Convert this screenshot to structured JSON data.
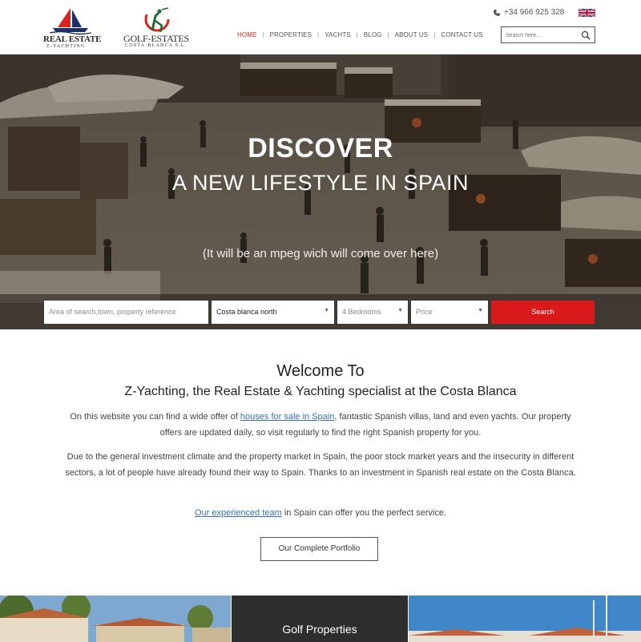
{
  "brand": {
    "logo1_title": "REAL ESTATE",
    "logo1_sub": "Z-YACHTING",
    "logo2_title": "GOLF-ESTATES",
    "logo2_sub": "COSTA·BLANCA S.L."
  },
  "header": {
    "phone": "+34 966 925 328",
    "language_icon": "uk-flag-icon",
    "nav": [
      {
        "label": "HOME",
        "active": true
      },
      {
        "label": "PROPERTIES"
      },
      {
        "label": "YACHTS"
      },
      {
        "label": "BLOG"
      },
      {
        "label": "ABOUT US"
      },
      {
        "label": "CONTACT US"
      }
    ],
    "search_placeholder": "Search here...",
    "accent_color": "#d9231c"
  },
  "hero": {
    "title": "DISCOVER",
    "subtitle": "A NEW LIFESTYLE IN  SPAIN",
    "note": "(It will be an mpeg wich will come over here)",
    "search": {
      "area_placeholder": "Area of search,town, property reference",
      "region": "Costa blanca north",
      "bedrooms": "4 Bedrooms",
      "price": "Price",
      "button": "Search"
    }
  },
  "welcome": {
    "heading": "Welcome To",
    "subheading": "Z-Yachting, the Real Estate & Yachting specialist at the Costa Blanca",
    "p1_before": "On this website you can find a wide offer of ",
    "p1_link": "houses for sale in Spain",
    "p1_after": ", fantastic Spanish villas, land and even yachts. Our property offers are updated daily, so visit regularly to find the right Spanish property for you.",
    "p2": "Due to the general investment climate and the property market in Spain, the poor stock market years and the insecurity in different sectors, a lot of people have already found their way to Spain. Thanks to an investment in Spanish real estate on the Costa Blanca.",
    "p3_link": "Our experienced team",
    "p3_after": " in Spain can offer you the perfect service.",
    "button": "Our Complete Portfolio"
  },
  "tiles": {
    "middle_label": "Golf Properties"
  }
}
